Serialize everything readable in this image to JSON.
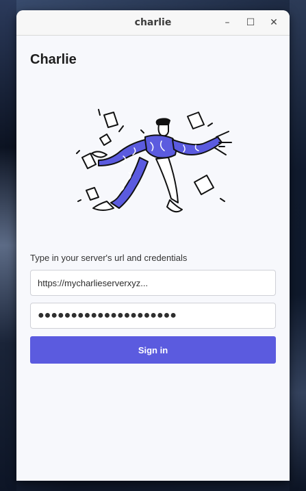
{
  "window": {
    "title": "charlie",
    "controls": {
      "minimize_glyph": "–",
      "maximize_glyph": "☐",
      "close_glyph": "✕"
    }
  },
  "app": {
    "title": "Charlie"
  },
  "illustration": {
    "icon": "person-juggling-papers-illustration",
    "accent_color": "#5b5bdf"
  },
  "login": {
    "prompt": "Type in your server's url and credentials",
    "server_url_value": "https://mycharlieserverxyz...",
    "password_value": "●●●●●●●●●●●●●●●●●●●●●",
    "signin_label": "Sign in",
    "button_color": "#5b5bdf"
  }
}
